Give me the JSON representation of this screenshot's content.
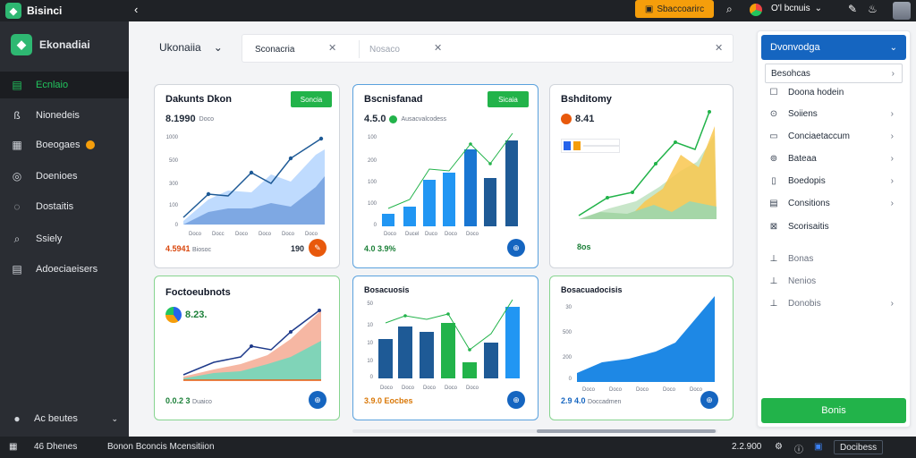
{
  "app": {
    "name": "Bisinci"
  },
  "topbar": {
    "back_glyph": "‹",
    "center_button": "Sbaccoarirc",
    "user_label": "O'l bcnuis",
    "user_chevron": "⌄",
    "icons": [
      "search-icon",
      "tools-icon",
      "bell-icon",
      "grid-icon"
    ]
  },
  "sidebar": {
    "brand": "Ekonadiai",
    "items": [
      {
        "label": "Ecnlaio",
        "icon": "▤"
      },
      {
        "label": "Nionedeis",
        "icon": "ß"
      },
      {
        "label": "Boeogaes",
        "icon": "▦"
      },
      {
        "label": "Doenioes",
        "icon": "◎"
      },
      {
        "label": "Dostaitis",
        "icon": "◌"
      },
      {
        "label": "Ssiely",
        "icon": "⌕"
      },
      {
        "label": "Adoeciaeisers",
        "icon": "▤"
      }
    ],
    "bottom": {
      "label": "Ac beutes",
      "chevron": "⌄"
    }
  },
  "header": {
    "workspace": "Ukonaiia",
    "workspace_chevron": "⌄",
    "filters": [
      {
        "label": "Sconacria",
        "close": "✕"
      },
      {
        "label": "Nosaco",
        "close": "✕"
      }
    ],
    "clear": "✕"
  },
  "cards": [
    {
      "title": "Dakunts Dkon",
      "button": "Soncia",
      "value": "8.1990",
      "value_sub": "Doco",
      "y_ticks": [
        "1000",
        "500",
        "300",
        "100",
        "0"
      ],
      "x_ticks": [
        "Doco",
        "Docc",
        "Doco",
        "Doco",
        "Doco",
        "Doco"
      ],
      "foot": "4.5941",
      "foot_sub": "Biosoc",
      "foot_right": "190"
    },
    {
      "title": "Bscnisfanad",
      "button": "Sicaia",
      "value": "4.5.0",
      "value_sub": "Ausacvalcodess",
      "y_ticks": [
        "100",
        "200",
        "100",
        "100",
        "0"
      ],
      "x_ticks": [
        "Doco",
        "Ducel",
        "Duco",
        "Doco",
        "Doco"
      ],
      "foot": "4.0 3.9%"
    },
    {
      "title": "Bshditomy",
      "value": "8.41",
      "foot": "8os"
    },
    {
      "title": "Foctoeubnots",
      "value": "8.23.",
      "foot": "0.0.2 3",
      "foot_sub": "Duaico"
    },
    {
      "title": "Bosacuosis",
      "y_ticks": [
        "50",
        "10",
        "10",
        "10",
        "0"
      ],
      "x_ticks": [
        "Doco",
        "Doco",
        "Doco",
        "Doco",
        "Doco"
      ],
      "foot": "3.9.0 Eocbes"
    },
    {
      "title": "Bosacuadocisis",
      "y_ticks": [
        "30",
        "500",
        "200",
        "0"
      ],
      "x_ticks": [
        "Doco",
        "Doco",
        "Doco",
        "Doco",
        "Doco"
      ],
      "foot": "2.9 4.0",
      "foot_sub": "Doccadmen"
    }
  ],
  "right_panel": {
    "header": "Dvonvodga",
    "header_chevron": "⌄",
    "subheader": "Besohcas",
    "items": [
      {
        "label": "Doona hodein",
        "icon": "☐",
        "chev": ""
      },
      {
        "label": "Soiiens",
        "icon": "⊙",
        "chev": "›"
      },
      {
        "label": "Conciaetaccum",
        "icon": "▭",
        "chev": "›"
      },
      {
        "label": "Bateaa",
        "icon": "⊚",
        "chev": "›"
      },
      {
        "label": "Boedopis",
        "icon": "▯",
        "chev": "›"
      },
      {
        "label": "Consitions",
        "icon": "▤",
        "chev": "›"
      },
      {
        "label": "Scorisaitis",
        "icon": "⊠",
        "chev": ""
      },
      {
        "label": "Bonas",
        "icon": "⊥",
        "chev": ""
      },
      {
        "label": "Nenios",
        "icon": "⊥",
        "chev": ""
      },
      {
        "label": "Donobis",
        "icon": "⊥",
        "chev": "›"
      }
    ],
    "button": "Bonis"
  },
  "statusbar": {
    "left_label": "46 Dhenes",
    "center_label": "Bonon Bconcis Mcensitiion",
    "right_value": "2.2.900",
    "right_label": "Docibess"
  },
  "colors": {
    "accent_green": "#22b34a",
    "accent_blue": "#1565c0",
    "topbar_orange": "#f59e0b",
    "sidebar_bg": "#2a2d33"
  }
}
